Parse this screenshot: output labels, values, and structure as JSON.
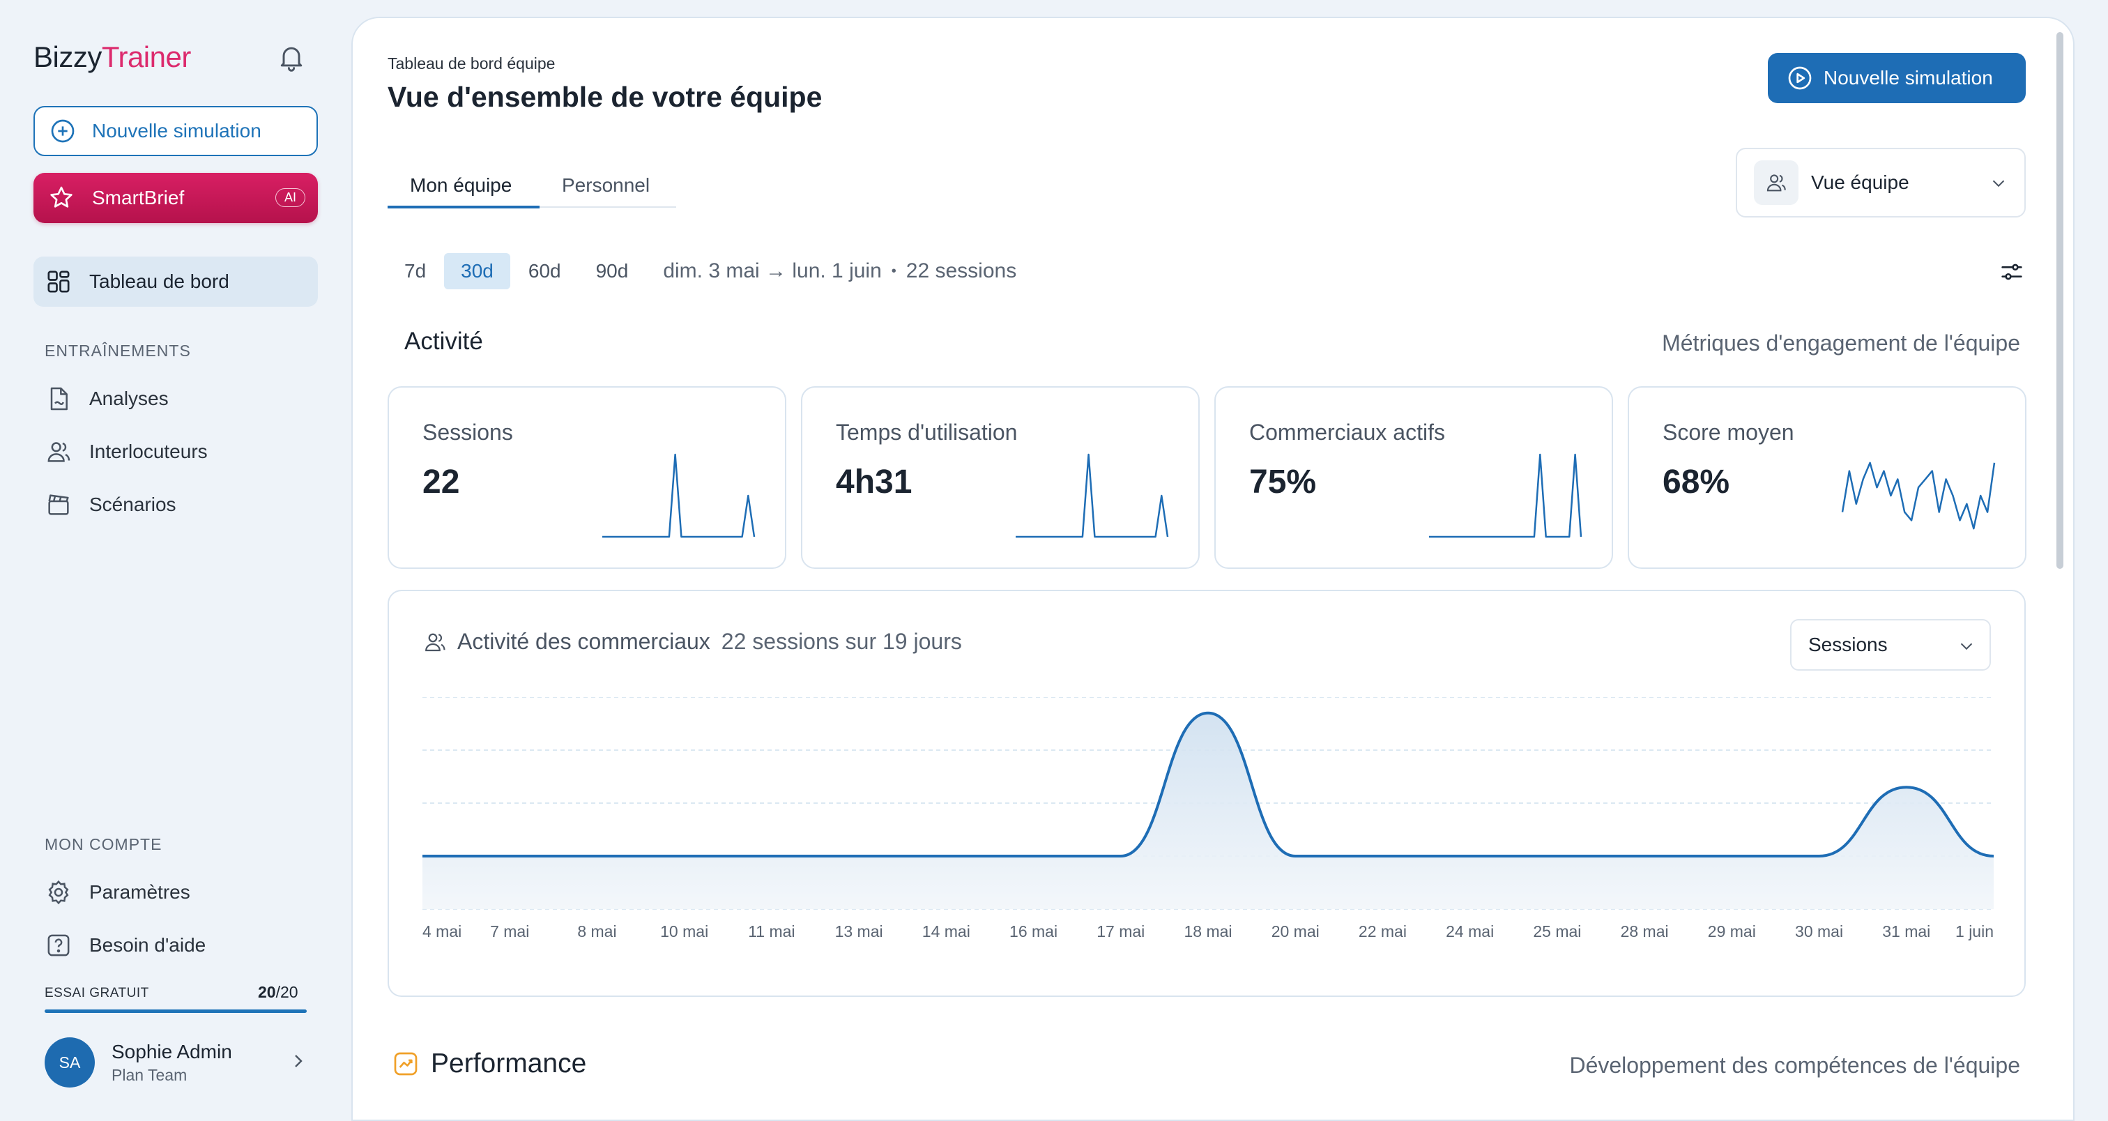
{
  "app": {
    "logo_part1": "Bizzy",
    "logo_part2": "Trainer"
  },
  "sidebar": {
    "new_sim_label": "Nouvelle simulation",
    "smartbrief_label": "SmartBrief",
    "smartbrief_badge": "AI",
    "dashboard_label": "Tableau de bord",
    "trainings_header": "ENTRAÎNEMENTS",
    "trainings": [
      {
        "label": "Analyses",
        "icon": "document-icon"
      },
      {
        "label": "Interlocuteurs",
        "icon": "users-icon"
      },
      {
        "label": "Scénarios",
        "icon": "clapper-icon"
      }
    ],
    "account_header": "MON COMPTE",
    "account": [
      {
        "label": "Paramètres",
        "icon": "gear-icon"
      },
      {
        "label": "Besoin d'aide",
        "icon": "help-icon"
      }
    ],
    "trial_label": "ESSAI GRATUIT",
    "trial_used": "20",
    "trial_total": "/20",
    "trial_progress": 1.0,
    "user": {
      "initials": "SA",
      "name": "Sophie Admin",
      "plan": "Plan Team"
    }
  },
  "header": {
    "breadcrumb": "Tableau de bord équipe",
    "title": "Vue d'ensemble de votre équipe",
    "new_sim_button": "Nouvelle simulation",
    "tabs": [
      {
        "label": "Mon équipe",
        "active": true
      },
      {
        "label": "Personnel",
        "active": false
      }
    ],
    "view_select": "Vue équipe"
  },
  "range": {
    "options": [
      "7d",
      "30d",
      "60d",
      "90d"
    ],
    "active": "30d",
    "period": "dim. 3 mai → lun. 1 juin",
    "sep": "•",
    "sessions": "22 sessions"
  },
  "activity": {
    "title": "Activité",
    "subtitle": "Métriques d'engagement de l'équipe",
    "kpis": [
      {
        "label": "Sessions",
        "value": "22",
        "spark": [
          0,
          0,
          0,
          0,
          0,
          0,
          0,
          0,
          0,
          0,
          0,
          0,
          1,
          0,
          0,
          0,
          0,
          0,
          0,
          0,
          0,
          0,
          0,
          0,
          0.5,
          0
        ]
      },
      {
        "label": "Temps d'utilisation",
        "value": "4h31",
        "spark": [
          0,
          0,
          0,
          0,
          0,
          0,
          0,
          0,
          0,
          0,
          0,
          0,
          1,
          0,
          0,
          0,
          0,
          0,
          0,
          0,
          0,
          0,
          0,
          0,
          0.5,
          0
        ]
      },
      {
        "label": "Commerciaux actifs",
        "value": "75%",
        "spark": [
          0,
          0,
          0,
          0,
          0,
          0,
          0,
          0,
          0,
          0,
          0,
          0,
          0,
          0,
          0,
          0,
          0,
          0,
          0,
          1,
          0,
          0,
          0,
          0,
          0,
          1,
          0
        ]
      },
      {
        "label": "Score moyen",
        "value": "68%",
        "spark": [
          0.3,
          0.8,
          0.4,
          0.7,
          0.9,
          0.6,
          0.8,
          0.5,
          0.7,
          0.3,
          0.2,
          0.6,
          0.7,
          0.8,
          0.3,
          0.7,
          0.5,
          0.2,
          0.4,
          0.1,
          0.5,
          0.3,
          0.9
        ]
      }
    ]
  },
  "chart_card": {
    "title": "Activité des commerciaux",
    "subtitle": "22 sessions sur 19 jours",
    "select": "Sessions"
  },
  "chart_data": {
    "type": "area",
    "x": [
      "4 mai",
      "7 mai",
      "8 mai",
      "10 mai",
      "11 mai",
      "13 mai",
      "14 mai",
      "16 mai",
      "17 mai",
      "18 mai",
      "20 mai",
      "22 mai",
      "24 mai",
      "25 mai",
      "28 mai",
      "29 mai",
      "30 mai",
      "31 mai",
      "1 juin"
    ],
    "values": [
      1,
      1,
      1,
      1,
      1,
      1,
      1,
      1,
      1,
      3.7,
      1,
      1,
      1,
      1,
      1,
      1,
      1,
      2.3,
      1
    ],
    "ylim": [
      0,
      4
    ],
    "grid": true,
    "colors": {
      "line": "#1e6db5",
      "fill_top": "#cfe0f0",
      "fill_bottom": "#f2f6fa",
      "grid": "#cfe0ee"
    }
  },
  "performance": {
    "title": "Performance",
    "subtitle": "Développement des compétences de l'équipe"
  },
  "colors": {
    "accent": "#1e6db5",
    "brand_pink": "#dc2a6d"
  }
}
